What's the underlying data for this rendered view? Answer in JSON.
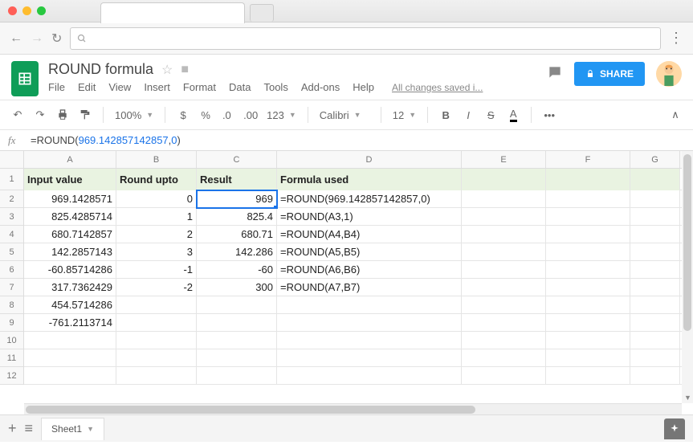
{
  "browser": {
    "omnibox_placeholder": ""
  },
  "doc": {
    "title": "ROUND formula",
    "share_label": "SHARE",
    "saved_text": "All changes saved i...",
    "menus": [
      "File",
      "Edit",
      "View",
      "Insert",
      "Format",
      "Data",
      "Tools",
      "Add-ons",
      "Help"
    ]
  },
  "toolbar": {
    "zoom": "100%",
    "font": "Calibri",
    "font_size": "12"
  },
  "formula_bar": {
    "prefix": "=ROUND(",
    "num1": "969.142857142857",
    "comma": ",",
    "num2": "0",
    "suffix": ")"
  },
  "columns": [
    "A",
    "B",
    "C",
    "D",
    "E",
    "F",
    "G"
  ],
  "row_numbers": [
    "1",
    "2",
    "3",
    "4",
    "5",
    "6",
    "7",
    "8",
    "9",
    "10",
    "11",
    "12"
  ],
  "headers": {
    "A": "Input value",
    "B": "Round upto",
    "C": "Result",
    "D": "Formula used"
  },
  "rows": [
    {
      "A": "969.1428571",
      "B": "0",
      "C": "969",
      "D": "=ROUND(969.142857142857,0)"
    },
    {
      "A": "825.4285714",
      "B": "1",
      "C": "825.4",
      "D": "=ROUND(A3,1)"
    },
    {
      "A": "680.7142857",
      "B": "2",
      "C": "680.71",
      "D": "=ROUND(A4,B4)"
    },
    {
      "A": "142.2857143",
      "B": "3",
      "C": "142.286",
      "D": "=ROUND(A5,B5)"
    },
    {
      "A": "-60.85714286",
      "B": "-1",
      "C": "-60",
      "D": "=ROUND(A6,B6)"
    },
    {
      "A": "317.7362429",
      "B": "-2",
      "C": "300",
      "D": "=ROUND(A7,B7)"
    },
    {
      "A": "454.5714286",
      "B": "",
      "C": "",
      "D": ""
    },
    {
      "A": "-761.2113714",
      "B": "",
      "C": "",
      "D": ""
    },
    {
      "A": "",
      "B": "",
      "C": "",
      "D": ""
    },
    {
      "A": "",
      "B": "",
      "C": "",
      "D": ""
    },
    {
      "A": "",
      "B": "",
      "C": "",
      "D": ""
    }
  ],
  "selected_cell": {
    "row": 1,
    "col": "C"
  },
  "sheet_tab": "Sheet1"
}
